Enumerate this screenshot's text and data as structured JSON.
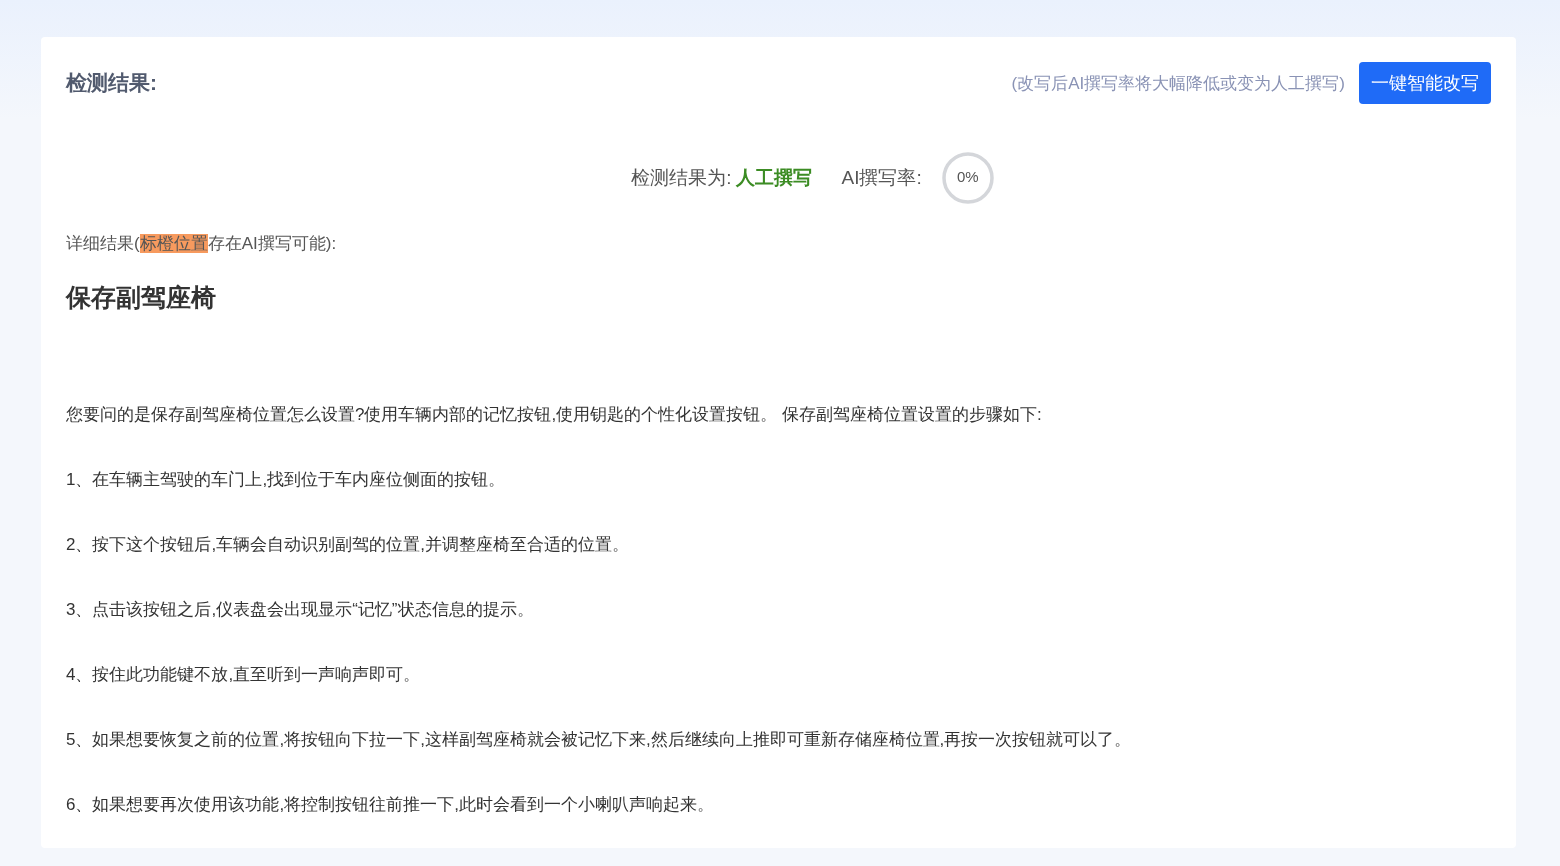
{
  "header": {
    "title": "检测结果:",
    "hint": "(改写后AI撰写率将大幅降低或变为人工撰写)",
    "button": "一键智能改写"
  },
  "summary": {
    "result_label": "检测结果为:",
    "result_value": "人工撰写",
    "rate_label": "AI撰写率:",
    "rate_value": "0%",
    "level": 0
  },
  "detail": {
    "prefix": "详细结果(",
    "highlight": "标橙位置",
    "suffix": "存在AI撰写可能):"
  },
  "article": {
    "title": "保存副驾座椅",
    "paragraphs": [
      "您要问的是保存副驾座椅位置怎么设置?使用车辆内部的记忆按钮,使用钥匙的个性化设置按钮。 保存副驾座椅位置设置的步骤如下:",
      "1、在车辆主驾驶的车门上,找到位于车内座位侧面的按钮。",
      "2、按下这个按钮后,车辆会自动识别副驾的位置,并调整座椅至合适的位置。",
      "3、点击该按钮之后,仪表盘会出现显示“记忆”状态信息的提示。",
      "4、按住此功能键不放,直至听到一声响声即可。",
      "5、如果想要恢复之前的位置,将按钮向下拉一下,这样副驾座椅就会被记忆下来,然后继续向上推即可重新存储座椅位置,再按一次按钮就可以了。",
      "6、如果想要再次使用该功能,将控制按钮往前推一下,此时会看到一个小喇叭声响起来。"
    ]
  }
}
